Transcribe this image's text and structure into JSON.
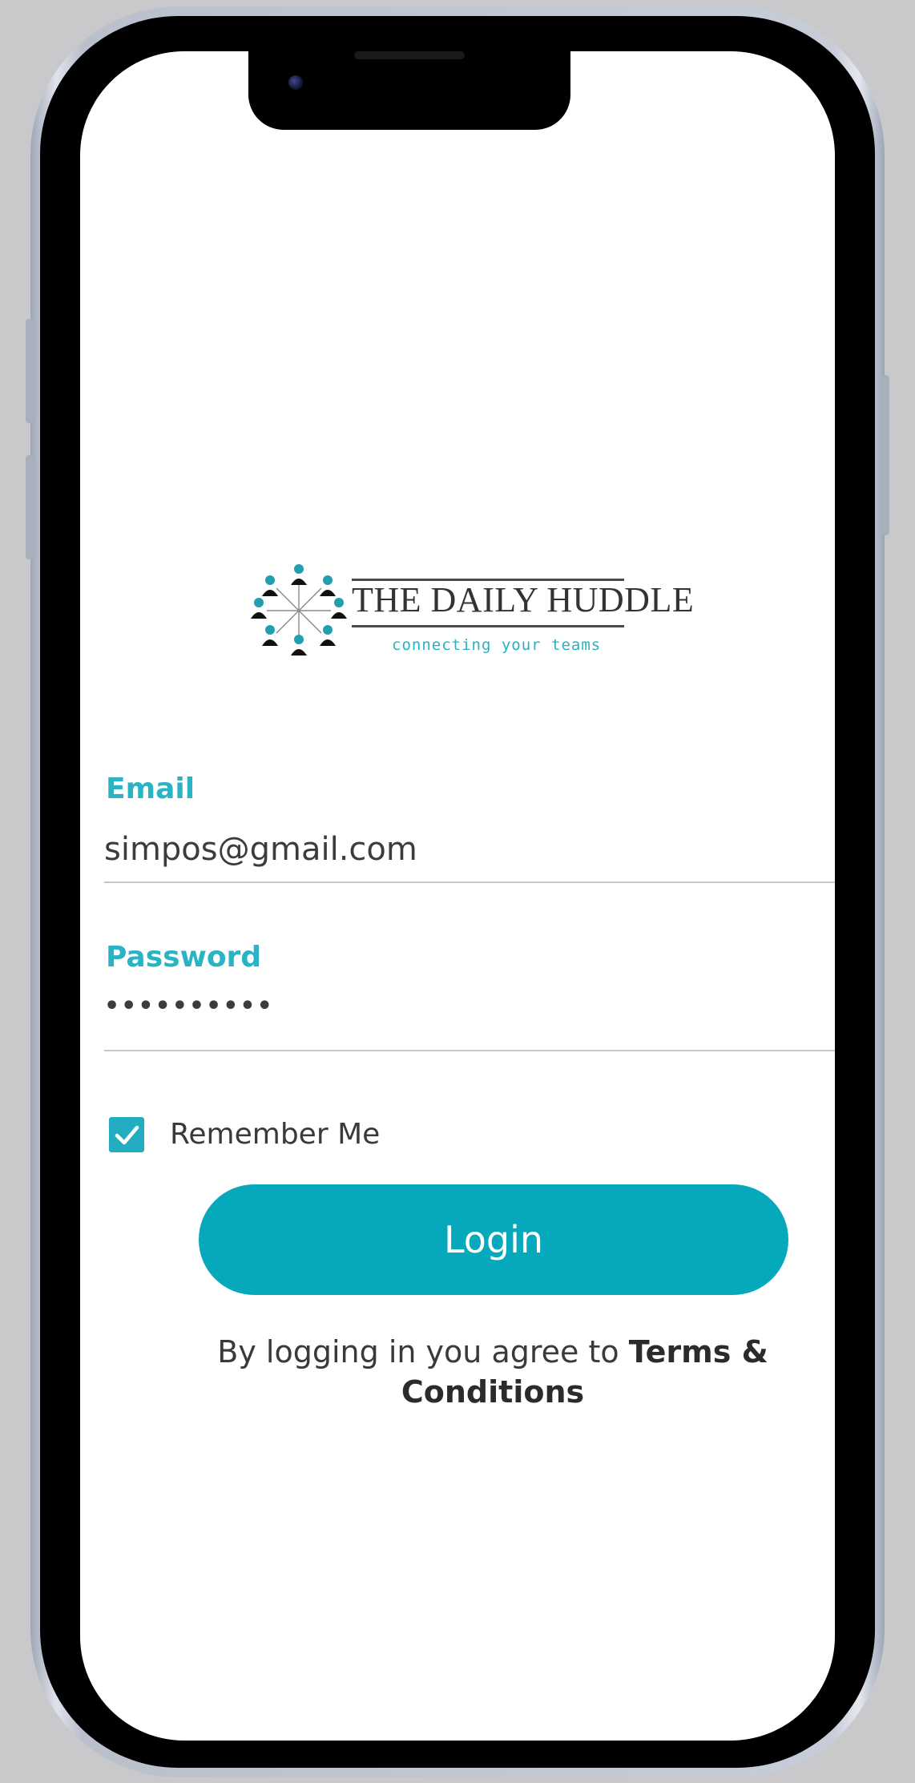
{
  "logo": {
    "title": "THE DAILY HUDDLE",
    "tagline": "connecting your teams"
  },
  "form": {
    "email": {
      "label": "Email",
      "value": "simpos@gmail.com"
    },
    "password": {
      "label": "Password",
      "value": "••••••••••"
    },
    "remember_me": {
      "label": "Remember Me",
      "checked": true
    },
    "login_label": "Login"
  },
  "terms": {
    "prefix": "By logging in you agree to",
    "link": "Terms & Conditions"
  },
  "colors": {
    "accent": "#06a8bc",
    "label": "#2ab3c5"
  }
}
